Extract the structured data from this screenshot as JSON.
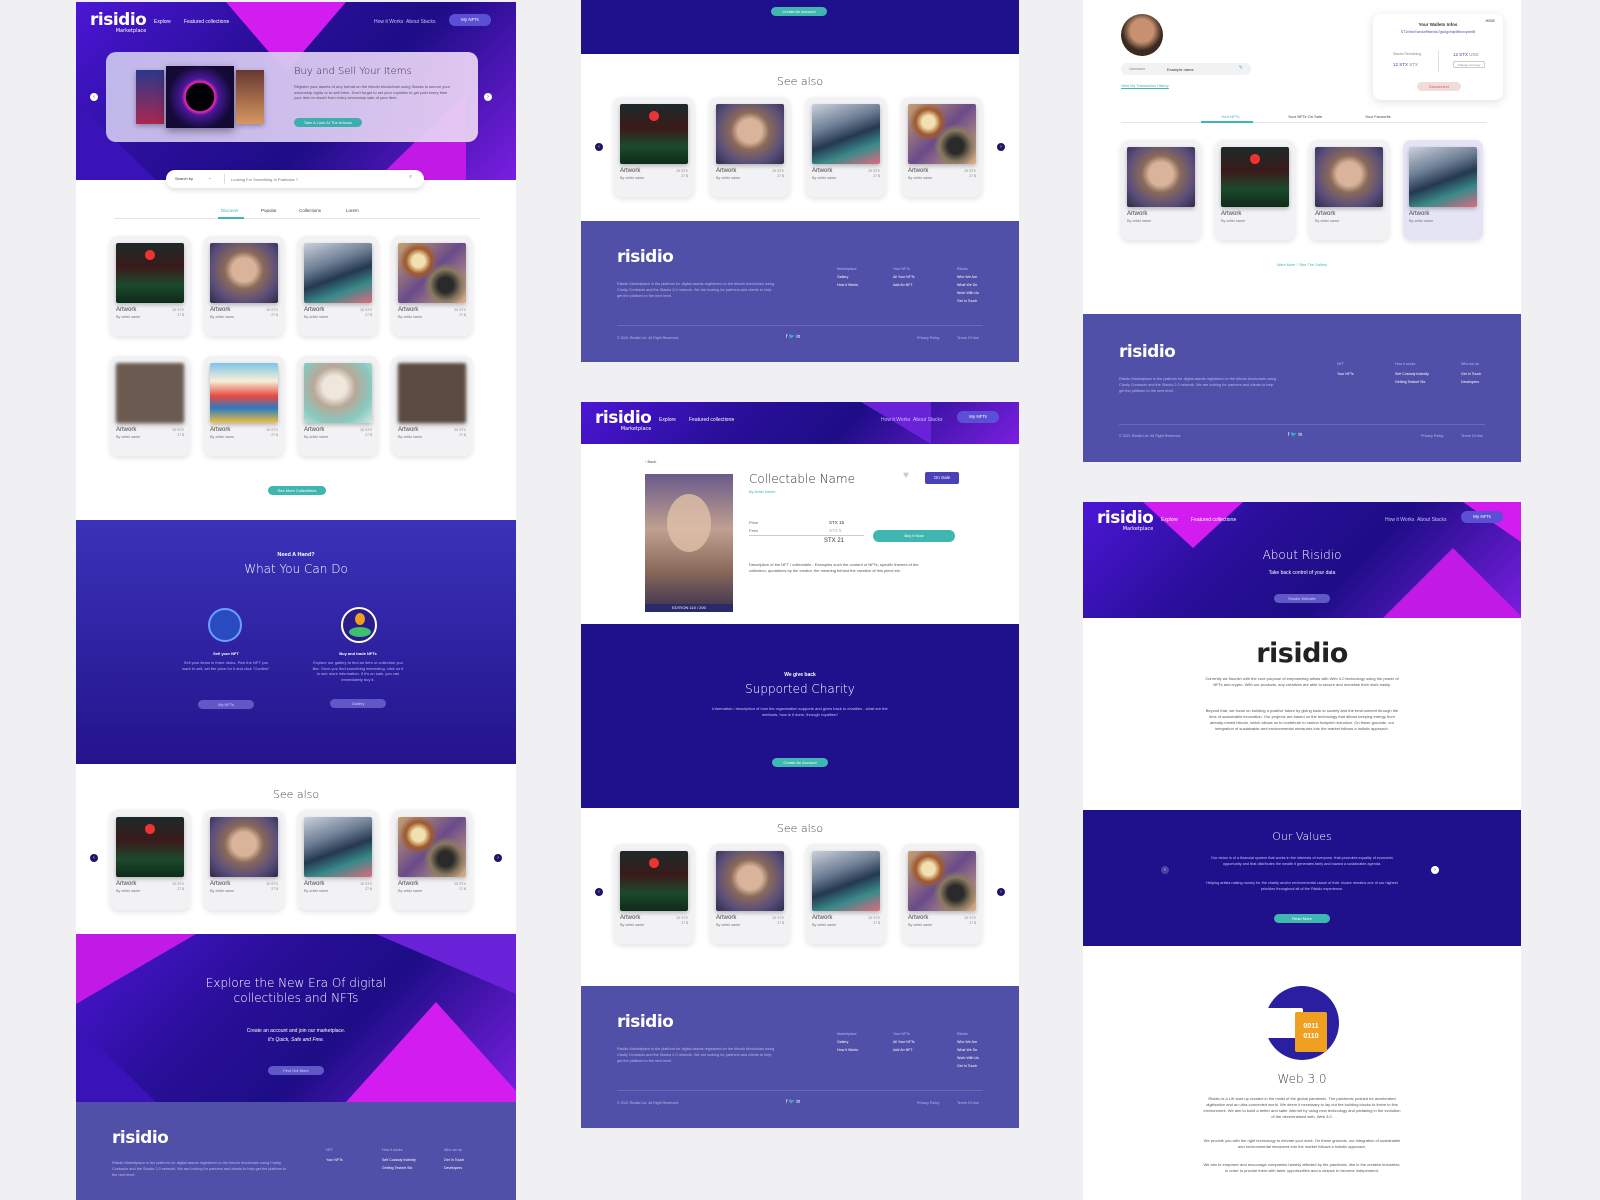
{
  "brand": {
    "logo": "risidio",
    "sub": "Marketplace"
  },
  "nav": {
    "explore": "Explore",
    "featured": "Featured collections",
    "how": "How it Works",
    "about": "About Stacks",
    "my_nfts": "My NFTs"
  },
  "home": {
    "hero_title": "Buy and Sell Your Items",
    "hero_text": "Register your assets of any format on the bitcoin blockchain using Stacks to secure your ownership rights or to sell them. Don't forget to set your royalties to get paid every time your item is resold from every secondary sale of your item.",
    "hero_btn": "Take A Look At The Artwork",
    "search_by": "Search by",
    "search_placeholder": "Looking For Something In Particular ?",
    "tabs": [
      "Discover",
      "Popular",
      "Collections",
      "Lorem"
    ],
    "see_more": "See More Collectibles",
    "hand_kicker": "Need A Hand?",
    "hand_title": "What You Can Do",
    "sell_title": "Sell your NFT",
    "sell_text": "Sell your items in three clicks. Pick the NFT you want to sell, set the price for it and click \"Confirm\"",
    "sell_btn": "My NFTs",
    "buy_title": "Buy and trade NFTs",
    "buy_text": "Explore our gallery to find an item or collection you like. Once you find something interesting, click on it to see more information. If it's on sale, you can immediately buy it.",
    "buy_btn": "Gallery",
    "explore_title": "Explore the New Era Of digital collectibles and NFTs",
    "explore_text": "Create an account and join our marketplace.",
    "explore_text2": "It's Quick, Safe and Free.",
    "explore_btn": "Find Out More"
  },
  "card": {
    "name": "Artwork",
    "artist": "By artist name",
    "price1": "20 STX",
    "price2": "27 $"
  },
  "see_also": "See also",
  "create_account": "Create An Account",
  "footer": {
    "desc": "Risidio Marketplace is the platform for digital assets registered on the bitcoin blockchain using Clarity Contracts and the Stacks 2.0 network. We are looking for partners and clients to help get the platform to the next level.",
    "col1_h": "Marketplace",
    "col1": [
      "Gallery",
      "How it Works"
    ],
    "col2_h": "Your NFTs",
    "col2": [
      "All Your NFTs",
      "Add An NFT"
    ],
    "col3_h": "Risidio",
    "col3": [
      "Who We Are",
      "What We Do",
      "Work With Us",
      "Get In Touch"
    ],
    "copy": "© 2021 Risidio Ltd. All Right Reserved.",
    "privacy": "Privacy Policy",
    "terms": "Terms Of Use",
    "alt_h1": "NFT",
    "alt1": [
      "Your NFTs"
    ],
    "alt_h2": "How it works",
    "alt2": [
      "Self Custody Indexity",
      "Getting Testnet Stx"
    ],
    "alt_h3": "Who we do",
    "alt3": [
      "Get In Touch",
      "Developers"
    ]
  },
  "detail": {
    "back": "Back",
    "name": "Collectable Name",
    "by": "By Artist Name",
    "status": "On Sale",
    "price_label": "Price",
    "fees_label": "Fees",
    "price_val": "STX 15",
    "fees_val": "STX 5",
    "total": "STX 21",
    "buy_btn": "Buy It Now",
    "edition": "EDITION 110 / 200",
    "desc": "Description of the NFT / collectable - Examples such the content of NFTs, specific themes of the collection, quotations by the creator, the meaning behind the creation of this piece etc.",
    "charity_kicker": "We give back",
    "charity_title": "Supported Charity",
    "charity_text": "Information / description of how the organisation supports and gives back to charities - what are the methods, how is it done, through royalties?"
  },
  "profile": {
    "username_label": "Username",
    "username": "Example name",
    "history": "View My Transaction History",
    "wallet_title": "Your Wallets Infos",
    "hide": "HIDE",
    "wallet_addr": "ST1x9rw7sm4wf9wrv6s7gw4gv9dp9ekvrvyxmf8",
    "remaining": "Stacks Remaining",
    "stx": "12 STX",
    "usd": "12 STX",
    "usd_unit": "USD",
    "stx_unit": "STX",
    "select": "Change currency",
    "disconnect": "Disconnect",
    "tabs": [
      "Your NFTs",
      "Your NFTs On Sale",
      "Your Favourite"
    ],
    "gallery_link": "Want More ? See The Gallery"
  },
  "about": {
    "title": "About Risidio",
    "sub": "Take back control of your data",
    "btn": "Risidio Website",
    "p1": "Currently we flourish with the core purpose of empowering artists with Web 3.0 technology using the power of NFTs and crypto. With our products, any creatives are able to secure and monetise their work easily.",
    "p2": "Beyond that, we focus on building a positive future by giving back to society and the environment through the lens of sustainable innovation. Our projects are based on the technology that allows keeping energy from already-mined bitcoin, which allows us to contribute to carbon footprint reduction. On these grounds, our integration of sustainable and environmental measures into the market follows a holistic approach.",
    "values_title": "Our Values",
    "values_text": "Our vision is of a financial system that works in the interests of everyone, that promotes equality of economic opportunity and that distributes the wealth it generates fairly and toward a sustainable agenda.",
    "values_text2": "Helping artists raising money for the charity and/or environmental cause of their choice remains one of our highest priorities throughout all of the Risidio experience.",
    "values_btn": "Read More",
    "web3_title": "Web 3.0",
    "web3_text": "Risidio is a UK start up created in the midst of the global pandemic. The pandemic pushed for accelerated digitisation and an ultra-connected world. We deem it necessary to lay out the building blocks to thrive in this environment. We aim to build a better and safer internet by using new technology and partaking in the evolution of the decentralised web, Web 3.0.",
    "web3_text2": "We provide you with the right technology to elevate your work. On these grounds, our integration of sustainable and environmental measures into the market follows a holistic approach.",
    "web3_text3": "We aim to empower and encourage companies harshly affected by the pandemic, like in the creative industries, in order to provide them with fairer opportunities and a chance to become independent."
  },
  "colors": {
    "accent": "#3fb7b0",
    "hero": "#2a0f9a",
    "footer": "#5150a8",
    "magenta": "#d21cf0"
  }
}
